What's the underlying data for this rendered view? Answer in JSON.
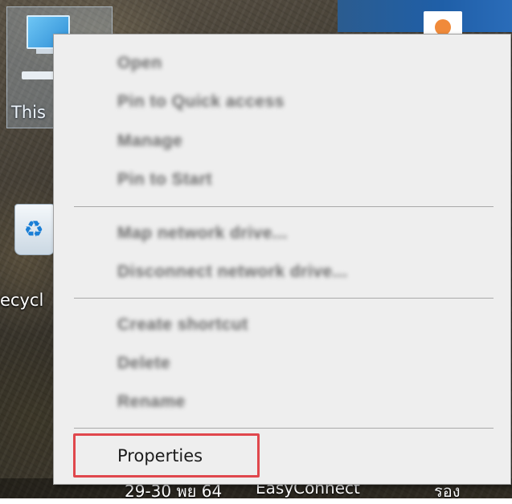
{
  "desktop": {
    "icons": [
      {
        "label": "This",
        "name": "This PC"
      },
      {
        "label": "ecycl",
        "name": "Recycle Bin"
      }
    ],
    "bottom_texts": [
      "29-30 พย 64",
      "EasyConnect",
      "รอง"
    ]
  },
  "context_menu": {
    "items": [
      {
        "label": "Open",
        "blurred": true
      },
      {
        "label": "Pin to Quick access",
        "blurred": true
      },
      {
        "label": "Manage",
        "blurred": true
      },
      {
        "label": "Pin to Start",
        "blurred": true
      },
      {
        "label": "Map network drive...",
        "blurred": true
      },
      {
        "label": "Disconnect network drive...",
        "blurred": true
      },
      {
        "label": "Create shortcut",
        "blurred": true
      },
      {
        "label": "Delete",
        "blurred": true
      },
      {
        "label": "Rename",
        "blurred": true
      },
      {
        "label": "Properties",
        "blurred": false,
        "highlighted": true
      }
    ]
  },
  "colors": {
    "menu_background": "#eeeeee",
    "highlight_border": "#e0474c",
    "separator": "#a9a9a9"
  },
  "icons": {
    "this_pc": "computer-icon",
    "recycle_bin": "recycle-bin-icon"
  }
}
